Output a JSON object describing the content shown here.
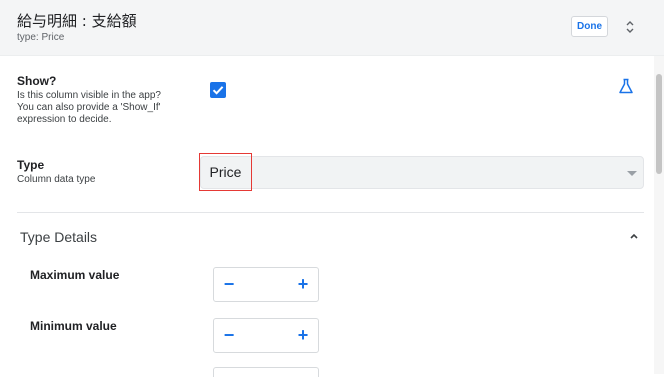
{
  "header": {
    "title": "給与明細 : 支給額",
    "subtitle_prefix": "type:",
    "subtitle_value": "Price",
    "done_label": "Done"
  },
  "show": {
    "label": "Show?",
    "help_line1": "Is this column visible in the app?",
    "help_line2": "You can also provide a 'Show_If'",
    "help_line3": "expression to decide.",
    "checked": true
  },
  "type_field": {
    "label": "Type",
    "help": "Column data type",
    "value": "Price"
  },
  "type_details": {
    "title": "Type Details",
    "max_label": "Maximum value",
    "max_value": "",
    "min_label": "Minimum value",
    "min_value": "",
    "minus": "−",
    "plus": "+"
  },
  "colors": {
    "accent": "#1a73e8",
    "highlight": "#e53935",
    "header_bg": "#f4f5f6"
  },
  "icons": [
    "sort-icon",
    "check-icon",
    "flask-icon",
    "dropdown-caret-icon",
    "chevron-up-icon"
  ]
}
